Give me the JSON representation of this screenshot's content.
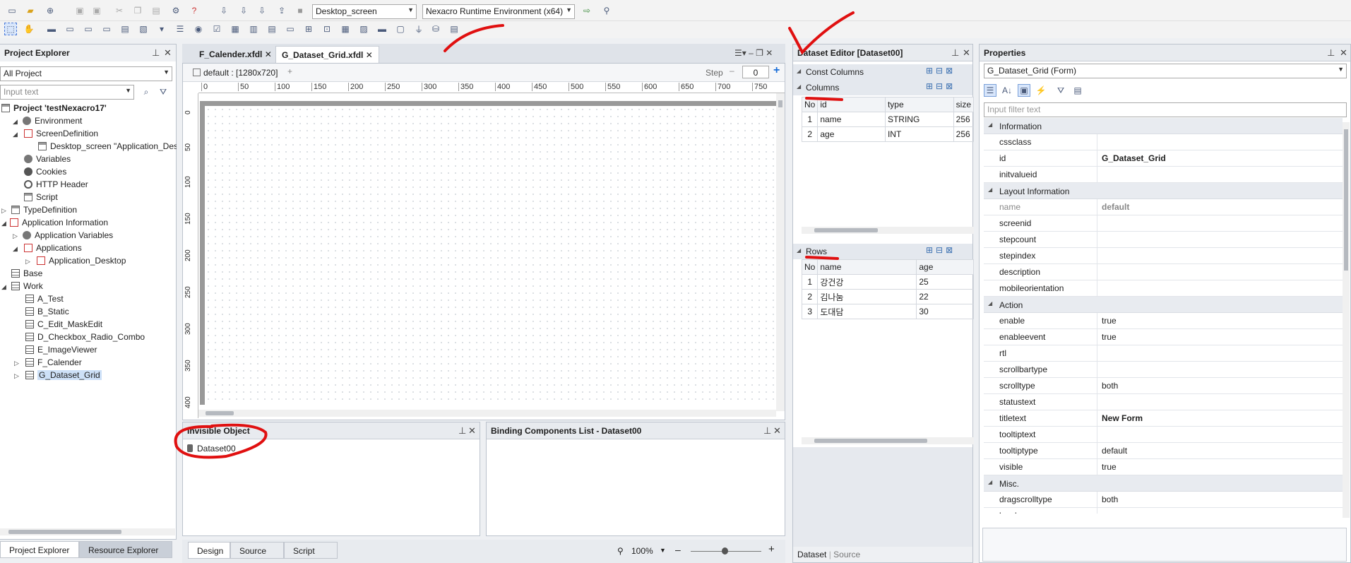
{
  "toolbar": {
    "screen_select": "Desktop_screen",
    "runtime_select": "Nexacro Runtime Environment (x64)"
  },
  "project_explorer": {
    "title": "Project Explorer",
    "filter_select": "All Project",
    "search_placeholder": "Input text",
    "tree": [
      {
        "label": "Project 'testNexacro17'",
        "bold": true
      },
      {
        "label": "Environment"
      },
      {
        "label": "ScreenDefinition"
      },
      {
        "label": "Desktop_screen \"Application_Des"
      },
      {
        "label": "Variables"
      },
      {
        "label": "Cookies"
      },
      {
        "label": "HTTP Header"
      },
      {
        "label": "Script"
      },
      {
        "label": "TypeDefinition"
      },
      {
        "label": "Application Information"
      },
      {
        "label": "Application Variables"
      },
      {
        "label": "Applications"
      },
      {
        "label": "Application_Desktop"
      },
      {
        "label": "Base"
      },
      {
        "label": "Work"
      },
      {
        "label": "A_Test"
      },
      {
        "label": "B_Static"
      },
      {
        "label": "C_Edit_MaskEdit"
      },
      {
        "label": "D_Checkbox_Radio_Combo"
      },
      {
        "label": "E_ImageViewer"
      },
      {
        "label": "F_Calender"
      },
      {
        "label": "G_Dataset_Grid"
      }
    ],
    "bottom_tabs": [
      "Project Explorer",
      "Resource Explorer"
    ]
  },
  "editor": {
    "tabs": [
      "F_Calender.xfdl",
      "G_Dataset_Grid.xfdl"
    ],
    "layout_label": "default : [1280x720]",
    "add_label": "+",
    "step_label": "Step",
    "step_value": "0",
    "ruler_h": [
      "0",
      "50",
      "100",
      "150",
      "200",
      "250",
      "300",
      "350",
      "400",
      "450",
      "500",
      "550",
      "600",
      "650",
      "700",
      "750"
    ],
    "ruler_v": [
      "0",
      "50",
      "100",
      "150",
      "200",
      "250",
      "300",
      "350",
      "400"
    ],
    "bottom_tabs": [
      "Design",
      "Source",
      "Script"
    ],
    "zoom": "100%"
  },
  "invisible_object": {
    "title": "Invisible Object",
    "items": [
      "Dataset00"
    ]
  },
  "binding_list": {
    "title": "Binding Components List - Dataset00"
  },
  "dataset_editor": {
    "title": "Dataset Editor [Dataset00]",
    "const_columns": "Const Columns",
    "columns_label": "Columns",
    "columns_headers": [
      "No",
      "id",
      "type",
      "size"
    ],
    "columns_rows": [
      [
        "1",
        "name",
        "STRING",
        "256"
      ],
      [
        "2",
        "age",
        "INT",
        "256"
      ]
    ],
    "rows_label": "Rows",
    "rows_headers": [
      "No",
      "name",
      "age"
    ],
    "rows_rows": [
      [
        "1",
        "강건강",
        "25"
      ],
      [
        "2",
        "김나눔",
        "22"
      ],
      [
        "3",
        "도대담",
        "30"
      ]
    ],
    "bottom_tabs": [
      "Dataset",
      "Source"
    ]
  },
  "properties": {
    "title": "Properties",
    "object_select": "G_Dataset_Grid  (Form)",
    "filter_placeholder": "Input filter text",
    "categories": [
      {
        "name": "Information",
        "props": [
          {
            "k": "cssclass",
            "v": ""
          },
          {
            "k": "id",
            "v": "G_Dataset_Grid",
            "bold": true
          },
          {
            "k": "initvalueid",
            "v": ""
          }
        ]
      },
      {
        "name": "Layout Information",
        "props": [
          {
            "k": "name",
            "v": "default",
            "grey": true
          },
          {
            "k": "screenid",
            "v": ""
          },
          {
            "k": "stepcount",
            "v": ""
          },
          {
            "k": "stepindex",
            "v": ""
          },
          {
            "k": "description",
            "v": ""
          },
          {
            "k": "mobileorientation",
            "v": ""
          }
        ]
      },
      {
        "name": "Action",
        "props": [
          {
            "k": "enable",
            "v": "true"
          },
          {
            "k": "enableevent",
            "v": "true"
          },
          {
            "k": "rtl",
            "v": ""
          },
          {
            "k": "scrollbartype",
            "v": ""
          },
          {
            "k": "scrolltype",
            "v": "both"
          },
          {
            "k": "statustext",
            "v": ""
          },
          {
            "k": "titletext",
            "v": "New Form",
            "bold": true
          },
          {
            "k": "tooltiptext",
            "v": ""
          },
          {
            "k": "tooltiptype",
            "v": "default"
          },
          {
            "k": "visible",
            "v": "true"
          }
        ]
      },
      {
        "name": "Misc.",
        "props": [
          {
            "k": "dragscrolltype",
            "v": "both"
          },
          {
            "k": "locale",
            "v": ""
          }
        ]
      }
    ]
  }
}
